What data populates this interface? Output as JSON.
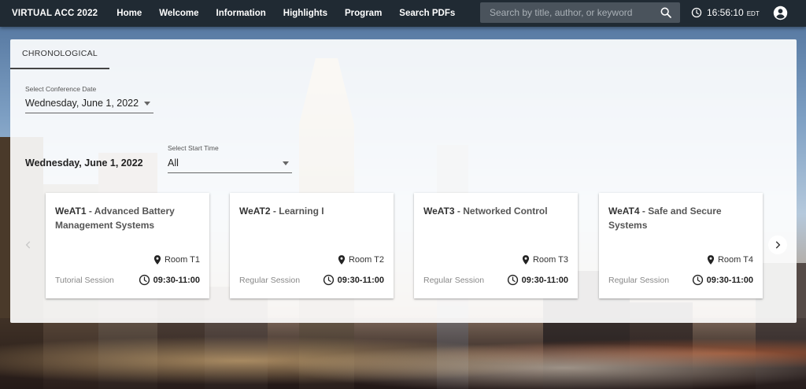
{
  "header": {
    "brand": "VIRTUAL ACC 2022",
    "nav": [
      "Home",
      "Welcome",
      "Information",
      "Highlights",
      "Program",
      "Search PDFs"
    ],
    "search_placeholder": "Search by title, author, or keyword",
    "time": "16:56:10",
    "timezone": "EDT"
  },
  "tabs": {
    "active": "CHRONOLOGICAL"
  },
  "date_select": {
    "label": "Select Conference Date",
    "value": "Wednesday, June 1, 2022"
  },
  "date_heading": "Wednesday, June 1, 2022",
  "time_select": {
    "label": "Select Start Time",
    "value": "All"
  },
  "sessions": [
    {
      "code": "WeAT1",
      "title": "Advanced Battery Management Systems",
      "room": "Room T1",
      "type": "Tutorial Session",
      "time": "09:30-11:00"
    },
    {
      "code": "WeAT2",
      "title": "Learning I",
      "room": "Room T2",
      "type": "Regular Session",
      "time": "09:30-11:00"
    },
    {
      "code": "WeAT3",
      "title": "Networked Control",
      "room": "Room T3",
      "type": "Regular Session",
      "time": "09:30-11:00"
    },
    {
      "code": "WeAT4",
      "title": "Safe and Secure Systems",
      "room": "Room T4",
      "type": "Regular Session",
      "time": "09:30-11:00"
    }
  ],
  "separator": " - ",
  "icons": {
    "search": "search-icon",
    "clock": "clock-icon",
    "account": "account-circle-icon",
    "location": "location-pin-icon",
    "prev": "chevron-left-icon",
    "next": "chevron-right-icon"
  },
  "colors": {
    "topbar": "#202a33",
    "search_bg": "#4a535c",
    "panel": "#ffffff"
  }
}
